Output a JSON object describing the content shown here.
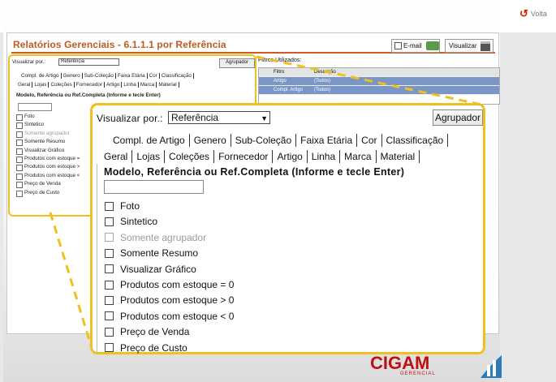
{
  "back_label": "Volta",
  "window_title": "Relatórios Gerenciais - 6.1.1.1 por Referência",
  "toolbar": {
    "email_label": "E-mail",
    "visualizar_label": "Visualizar"
  },
  "small_panel": {
    "view_label": "Visualizar por.:",
    "view_value": "Referência",
    "group_button": "Agrupador",
    "tabs_row1": [
      "Compl. de Artigo",
      "Genero",
      "Sub-Coleção",
      "Faixa Etária",
      "Cor",
      "Classificação"
    ],
    "tabs_row2": [
      "Geral",
      "Lojas",
      "Coleções",
      "Fornecedor",
      "Artigo",
      "Linha",
      "Marca",
      "Material"
    ],
    "heading": "Modelo, Referência ou Ref.Completa (Informe e tecle Enter)",
    "options": [
      "Foto",
      "Sintetico",
      "Somente agrupador",
      "Somente Resumo",
      "Visualizar Gráfico",
      "Produtos com estoque =",
      "Produtos com estoque >",
      "Produtos com estoque <",
      "Preço de Venda",
      "Preço de Custo"
    ]
  },
  "filters": {
    "label": "Filtros Utilizados:",
    "headers": [
      "Filtro",
      "Descrição"
    ],
    "rows": [
      {
        "filtro": "Artigo",
        "descricao": "(Todos)"
      },
      {
        "filtro": "Compl. Artigo",
        "descricao": "(Todos)"
      }
    ]
  },
  "zoom": {
    "view_label": "Visualizar por.:",
    "view_value": "Referência",
    "group_button": "Agrupador",
    "tabs_row1": [
      "Compl. de Artigo",
      "Genero",
      "Sub-Coleção",
      "Faixa Etária",
      "Cor",
      "Classificação"
    ],
    "tabs_row2": [
      "Geral",
      "Lojas",
      "Coleções",
      "Fornecedor",
      "Artigo",
      "Linha",
      "Marca",
      "Material"
    ],
    "heading": "Modelo, Referência ou Ref.Completa (Informe e tecle Enter)",
    "input_value": "",
    "options": [
      {
        "label": "Foto",
        "disabled": false
      },
      {
        "label": "Sintetico",
        "disabled": false
      },
      {
        "label": "Somente agrupador",
        "disabled": true
      },
      {
        "label": "Somente Resumo",
        "disabled": false
      },
      {
        "label": "Visualizar Gráfico",
        "disabled": false
      },
      {
        "label": "Produtos com estoque = 0",
        "disabled": false
      },
      {
        "label": "Produtos com estoque > 0",
        "disabled": false
      },
      {
        "label": "Produtos com estoque < 0",
        "disabled": false
      },
      {
        "label": "Preço de Venda",
        "disabled": false
      },
      {
        "label": "Preço de Custo",
        "disabled": false
      }
    ]
  },
  "logo": {
    "name": "CIGAM",
    "subtitle": "GERENCIAL"
  },
  "colors": {
    "highlight": "#f0c020",
    "title": "#c05a22",
    "brand": "#c01010",
    "selection": "#7a96c6"
  }
}
